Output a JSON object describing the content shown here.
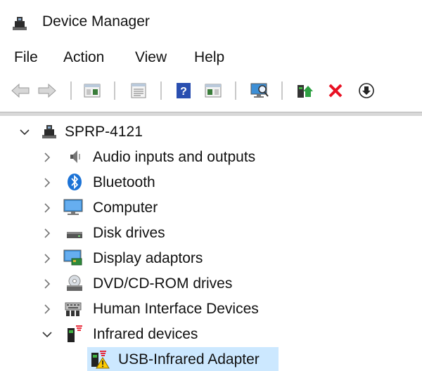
{
  "window": {
    "title": "Device Manager",
    "app_icon": "device-manager-icon"
  },
  "menu": {
    "items": [
      "File",
      "Action",
      "View",
      "Help"
    ]
  },
  "toolbar": {
    "buttons": [
      "back-arrow-icon",
      "forward-arrow-icon",
      "show-hide-console-tree-icon",
      "properties-icon",
      "help-icon",
      "action-pane-icon",
      "scan-hardware-changes-icon",
      "update-driver-icon",
      "uninstall-device-icon",
      "disable-device-icon"
    ]
  },
  "tree": {
    "root": {
      "label": "SPRP-4121",
      "expanded": true
    },
    "categories": [
      {
        "label": "Audio inputs and outputs",
        "icon": "speaker-icon"
      },
      {
        "label": "Bluetooth",
        "icon": "bluetooth-icon"
      },
      {
        "label": "Computer",
        "icon": "monitor-icon"
      },
      {
        "label": "Disk drives",
        "icon": "disk-drive-icon"
      },
      {
        "label": "Display adaptors",
        "icon": "display-adapter-icon"
      },
      {
        "label": "DVD/CD-ROM drives",
        "icon": "dvd-drive-icon"
      },
      {
        "label": "Human Interface Devices",
        "icon": "hid-keyboard-icon"
      },
      {
        "label": "Infrared devices",
        "icon": "infrared-icon",
        "expanded": true
      }
    ],
    "child": {
      "label": "USB-Infrared Adapter",
      "icon": "infrared-warning-icon",
      "selected": true
    }
  },
  "colors": {
    "selection": "#cce8ff",
    "accent": "#1c73d6",
    "error_red": "#e81123",
    "warning_yellow": "#ffcc00"
  }
}
